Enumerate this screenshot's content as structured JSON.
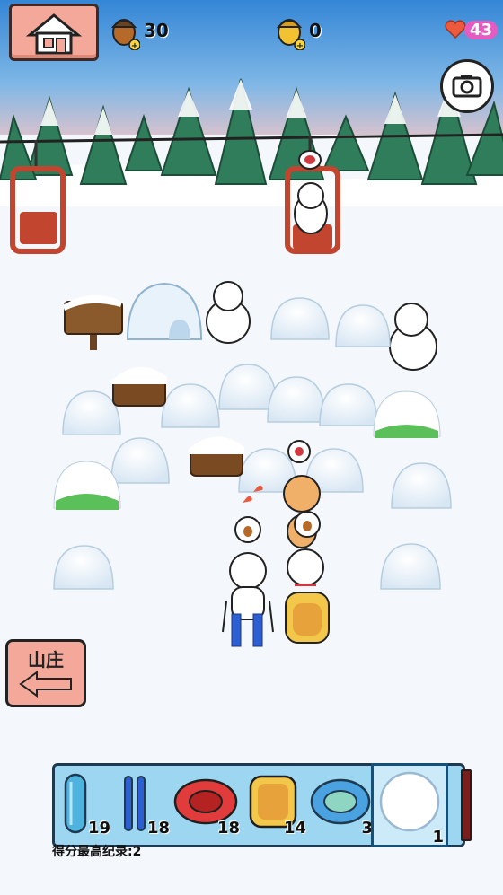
{
  "hud": {
    "acorn_count": "30",
    "golden_acorn_count": "0",
    "hearts_count": "43"
  },
  "buttons": {
    "villa_label": "山庄"
  },
  "inventory": [
    {
      "icon": "blue-ski-icon",
      "count": "19"
    },
    {
      "icon": "blue-skis-pair-icon",
      "count": "18"
    },
    {
      "icon": "red-tube-icon",
      "count": "18"
    },
    {
      "icon": "yellow-sled-icon",
      "count": "14"
    },
    {
      "icon": "blue-tube-icon",
      "count": "3"
    },
    {
      "icon": "snowball-icon",
      "count": "1"
    }
  ],
  "score_record": "得分最高纪录:2",
  "colors": {
    "sky": "#3f8fd8",
    "snow": "#f4f7fb",
    "toolbar": "#9cd6f0",
    "button_pink": "#f3a89a",
    "heart_badge": "#e65bbf"
  }
}
